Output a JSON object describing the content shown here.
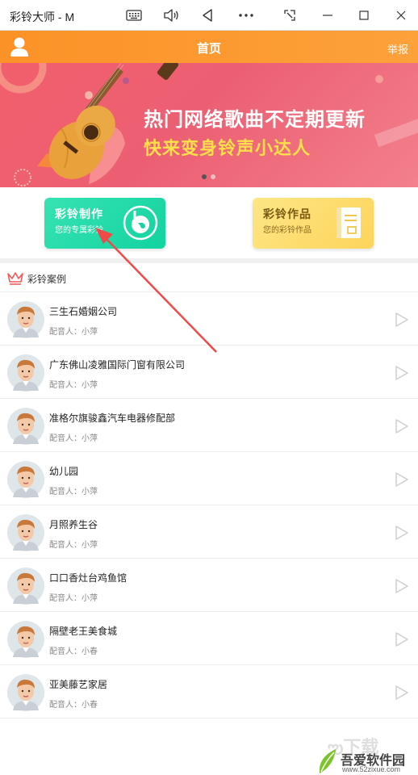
{
  "window": {
    "title": "彩铃大师 - M"
  },
  "header": {
    "title": "首页",
    "report_label": "举报"
  },
  "banner": {
    "line1": "热门网络歌曲不定期更新",
    "line2": "快来变身铃声小达人",
    "slide_count": 2,
    "active_slide": 1
  },
  "features": {
    "make": {
      "title": "彩铃制作",
      "subtitle": "您的专属彩铃"
    },
    "works": {
      "title": "彩铃作品",
      "subtitle": "您的彩铃作品"
    }
  },
  "cases": {
    "title": "彩铃案例",
    "items": [
      {
        "name": "三生石婚姻公司",
        "voice": "配音人：小萍"
      },
      {
        "name": "广东佛山凌雅国际门窗有限公司",
        "voice": "配音人：小萍"
      },
      {
        "name": "准格尔旗骏鑫汽车电器修配部",
        "voice": "配音人：小萍"
      },
      {
        "name": "幼儿园",
        "voice": "配音人：小萍"
      },
      {
        "name": "月照养生谷",
        "voice": "配音人：小萍"
      },
      {
        "name": "口口香灶台鸡鱼馆",
        "voice": "配音人：小萍"
      },
      {
        "name": "隔壁老王美食城",
        "voice": "配音人：小春"
      },
      {
        "name": "亚美藤艺家居",
        "voice": "配音人：小春"
      }
    ]
  },
  "watermark": {
    "ghost": "ఌ下载",
    "text": "吾爱软件园",
    "url": "www.52zixue.com"
  },
  "colors": {
    "header_orange": "#fb9227",
    "banner_pink": "#f25f6c",
    "make_green": "#12d3a0",
    "works_yellow": "#fdd45a",
    "arrow_red": "#ee4a4a"
  }
}
